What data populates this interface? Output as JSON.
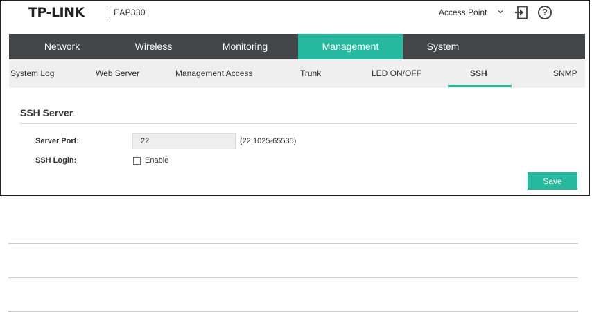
{
  "header": {
    "brand": "TP-LINK",
    "model": "EAP330",
    "mode": "Access Point",
    "chevron_icon": "chevron-down-icon",
    "logout_icon": "logout-icon",
    "help_icon": "help-icon",
    "help_glyph": "?"
  },
  "main_nav": {
    "tabs": [
      {
        "label": "Network"
      },
      {
        "label": "Wireless"
      },
      {
        "label": "Monitoring"
      },
      {
        "label": "Management"
      },
      {
        "label": "System"
      }
    ],
    "active": "Management"
  },
  "sub_nav": {
    "tabs": [
      {
        "label": "System Log"
      },
      {
        "label": "Web Server"
      },
      {
        "label": "Management Access"
      },
      {
        "label": "Trunk"
      },
      {
        "label": "LED ON/OFF"
      },
      {
        "label": "SSH"
      },
      {
        "label": "SNMP"
      }
    ],
    "active": "SSH"
  },
  "ssh_server": {
    "title": "SSH Server",
    "server_port_label": "Server Port:",
    "server_port_value": "22",
    "server_port_hint": "(22,1025-65535)",
    "ssh_login_label": "SSH Login:",
    "ssh_login_option": "Enable",
    "ssh_login_enabled": false,
    "save_label": "Save"
  },
  "colors": {
    "accent": "#26b9a0",
    "nav_bg": "#424649",
    "subnav_bg": "#efefef"
  }
}
